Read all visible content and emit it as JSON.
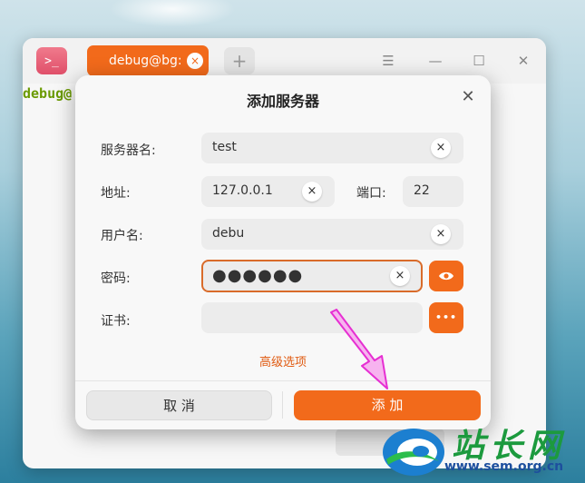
{
  "terminal": {
    "app_icon_glyph": ">_",
    "tab_label": "debug@bg: ~",
    "tab_close": "×",
    "new_tab": "+",
    "menu_glyph": "☰",
    "minimize_glyph": "—",
    "maximize_glyph": "☐",
    "close_glyph": "✕",
    "prompt": "debug@"
  },
  "dialog": {
    "title": "添加服务器",
    "close_glyph": "✕",
    "server_name_label": "服务器名:",
    "server_name_value": "test",
    "address_label": "地址:",
    "address_value": "127.0.0.1",
    "port_label": "端口:",
    "port_value": "22",
    "username_label": "用户名:",
    "username_value": "debu",
    "password_label": "密码:",
    "password_mask": "●●●●●●",
    "certificate_label": "证书:",
    "more_glyph": "•••",
    "advanced_options": "高级选项",
    "cancel_label": "取 消",
    "add_label": "添 加",
    "clear_glyph": "×"
  },
  "watermark": {
    "brand": "站长网",
    "url": "www.sem.org.cn"
  },
  "colors": {
    "accent": "#f26a1b",
    "annotation_arrow": "#e62fd2"
  }
}
